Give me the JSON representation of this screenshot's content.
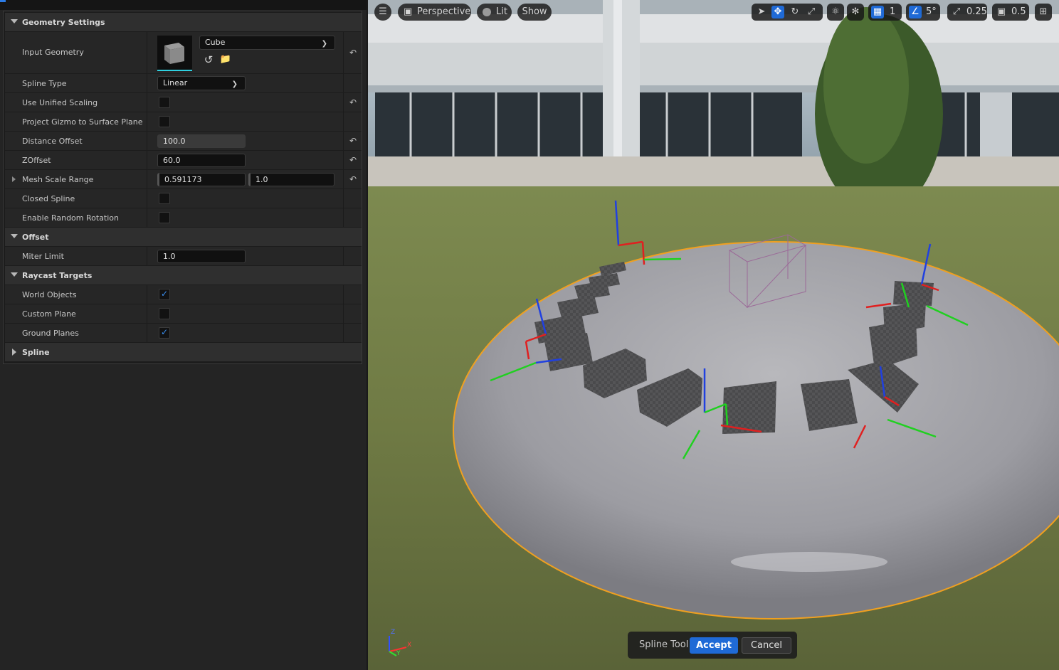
{
  "details": {
    "categories": {
      "geometry": "Geometry Settings",
      "offset": "Offset",
      "raycast": "Raycast Targets",
      "spline": "Spline"
    },
    "input_geometry": {
      "label": "Input Geometry",
      "value": "Cube"
    },
    "spline_type": {
      "label": "Spline Type",
      "value": "Linear"
    },
    "use_unified_scaling": {
      "label": "Use Unified Scaling",
      "checked": false
    },
    "project_gizmo": {
      "label": "Project Gizmo to Surface Plane",
      "checked": false
    },
    "distance_offset": {
      "label": "Distance Offset",
      "value": "100.0"
    },
    "zoffset": {
      "label": "ZOffset",
      "value": "60.0"
    },
    "mesh_scale_range": {
      "label": "Mesh Scale Range",
      "min": "0.591173",
      "max": "1.0"
    },
    "closed_spline": {
      "label": "Closed Spline",
      "checked": false
    },
    "random_rotation": {
      "label": "Enable Random Rotation",
      "checked": false
    },
    "miter_limit": {
      "label": "Miter Limit",
      "value": "1.0"
    },
    "world_objects": {
      "label": "World Objects",
      "checked": true
    },
    "custom_plane": {
      "label": "Custom Plane",
      "checked": false
    },
    "ground_planes": {
      "label": "Ground Planes",
      "checked": true
    }
  },
  "viewport": {
    "perspective": "Perspective",
    "lit": "Lit",
    "show": "Show",
    "grid_snap": "1",
    "rotation_snap": "5°",
    "scale_snap": "0.25",
    "camera_speed": "0.5",
    "axis_labels": {
      "z": "Z",
      "x": "X",
      "y": "Y"
    }
  },
  "toolbox": {
    "title": "Spline Tool",
    "accept": "Accept",
    "cancel": "Cancel"
  },
  "colors": {
    "accent": "#1f6ad6",
    "selection_outline": "#f0a020",
    "gizmo_x": "#e02020",
    "gizmo_y": "#20d020",
    "gizmo_z": "#2040e0"
  }
}
